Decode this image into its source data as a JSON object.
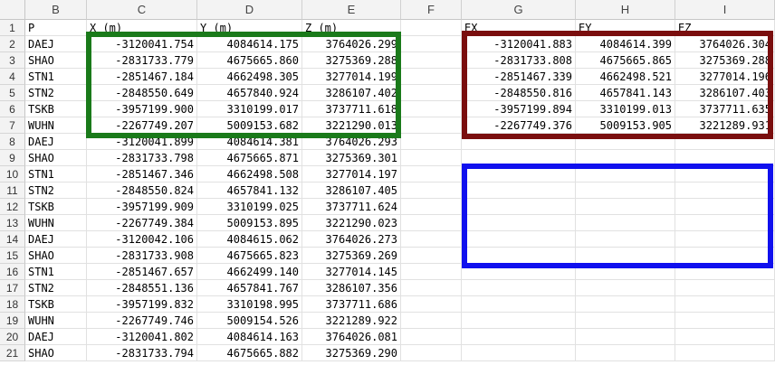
{
  "columns": [
    "B",
    "C",
    "D",
    "E",
    "F",
    "G",
    "H",
    "I"
  ],
  "headers": {
    "B": "P",
    "C": "X (m)",
    "D": "Y (m)",
    "E": "Z (m)",
    "G": "EX",
    "H": "EY",
    "I": "EZ"
  },
  "rows": [
    {
      "n": "1"
    },
    {
      "n": "2",
      "p": "DAEJ",
      "x": "-3120041.754",
      "y": "4084614.175",
      "z": "3764026.299",
      "ex": "-3120041.883",
      "ey": "4084614.399",
      "ez": "3764026.304"
    },
    {
      "n": "3",
      "p": "SHAO",
      "x": "-2831733.779",
      "y": "4675665.860",
      "z": "3275369.288",
      "ex": "-2831733.808",
      "ey": "4675665.865",
      "ez": "3275369.288"
    },
    {
      "n": "4",
      "p": "STN1",
      "x": "-2851467.184",
      "y": "4662498.305",
      "z": "3277014.199",
      "ex": "-2851467.339",
      "ey": "4662498.521",
      "ez": "3277014.196"
    },
    {
      "n": "5",
      "p": "STN2",
      "x": "-2848550.649",
      "y": "4657840.924",
      "z": "3286107.402",
      "ex": "-2848550.816",
      "ey": "4657841.143",
      "ez": "3286107.403"
    },
    {
      "n": "6",
      "p": "TSKB",
      "x": "-3957199.900",
      "y": "3310199.017",
      "z": "3737711.618",
      "ex": "-3957199.894",
      "ey": "3310199.013",
      "ez": "3737711.635"
    },
    {
      "n": "7",
      "p": "WUHN",
      "x": "-2267749.207",
      "y": "5009153.682",
      "z": "3221290.013",
      "ex": "-2267749.376",
      "ey": "5009153.905",
      "ez": "3221289.931"
    },
    {
      "n": "8",
      "p": "DAEJ",
      "x": "-3120041.899",
      "y": "4084614.381",
      "z": "3764026.293"
    },
    {
      "n": "9",
      "p": "SHAO",
      "x": "-2831733.798",
      "y": "4675665.871",
      "z": "3275369.301"
    },
    {
      "n": "10",
      "p": "STN1",
      "x": "-2851467.346",
      "y": "4662498.508",
      "z": "3277014.197"
    },
    {
      "n": "11",
      "p": "STN2",
      "x": "-2848550.824",
      "y": "4657841.132",
      "z": "3286107.405"
    },
    {
      "n": "12",
      "p": "TSKB",
      "x": "-3957199.909",
      "y": "3310199.025",
      "z": "3737711.624"
    },
    {
      "n": "13",
      "p": "WUHN",
      "x": "-2267749.384",
      "y": "5009153.895",
      "z": "3221290.023"
    },
    {
      "n": "14",
      "p": "DAEJ",
      "x": "-3120042.106",
      "y": "4084615.062",
      "z": "3764026.273"
    },
    {
      "n": "15",
      "p": "SHAO",
      "x": "-2831733.908",
      "y": "4675665.823",
      "z": "3275369.269"
    },
    {
      "n": "16",
      "p": "STN1",
      "x": "-2851467.657",
      "y": "4662499.140",
      "z": "3277014.145"
    },
    {
      "n": "17",
      "p": "STN2",
      "x": "-2848551.136",
      "y": "4657841.767",
      "z": "3286107.356"
    },
    {
      "n": "18",
      "p": "TSKB",
      "x": "-3957199.832",
      "y": "3310198.995",
      "z": "3737711.686"
    },
    {
      "n": "19",
      "p": "WUHN",
      "x": "-2267749.746",
      "y": "5009154.526",
      "z": "3221289.922"
    },
    {
      "n": "20",
      "p": "DAEJ",
      "x": "-3120041.802",
      "y": "4084614.163",
      "z": "3764026.081"
    },
    {
      "n": "21",
      "p": "SHAO",
      "x": "-2831733.794",
      "y": "4675665.882",
      "z": "3275369.290"
    }
  ],
  "highlights": {
    "green": "#1a7a1a",
    "darkred": "#7a0e0e",
    "blue": "#1010ee"
  }
}
